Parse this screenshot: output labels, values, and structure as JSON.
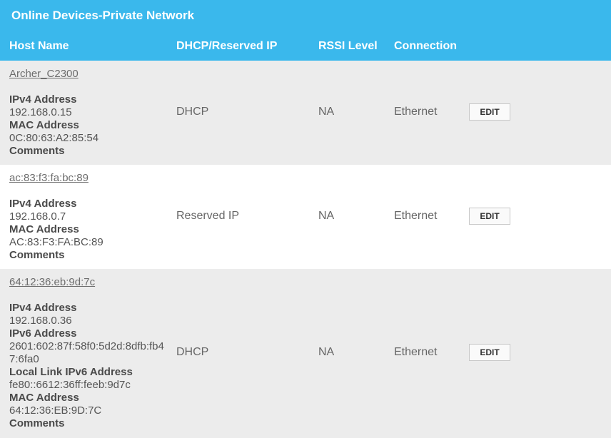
{
  "title": "Online Devices-Private Network",
  "columns": {
    "host": "Host Name",
    "dhcp": "DHCP/Reserved IP",
    "rssi": "RSSI Level",
    "connection": "Connection"
  },
  "devices": [
    {
      "host": "Archer_C2300",
      "ipv4_label": "IPv4 Address",
      "ipv4": "192.168.0.15",
      "mac_label": "MAC Address",
      "mac": "0C:80:63:A2:85:54",
      "comments_label": "Comments",
      "ip_type": "DHCP",
      "rssi": "NA",
      "connection": "Ethernet",
      "edit": "EDIT"
    },
    {
      "host": "ac:83:f3:fa:bc:89",
      "ipv4_label": "IPv4 Address",
      "ipv4": "192.168.0.7",
      "mac_label": "MAC Address",
      "mac": "AC:83:F3:FA:BC:89",
      "comments_label": "Comments",
      "ip_type": "Reserved IP",
      "rssi": "NA",
      "connection": "Ethernet",
      "edit": "EDIT"
    },
    {
      "host": "64:12:36:eb:9d:7c",
      "ipv4_label": "IPv4 Address",
      "ipv4": "192.168.0.36",
      "ipv6_label": "IPv6 Address",
      "ipv6": "2601:602:87f:58f0:5d2d:8dfb:fb47:6fa0",
      "linklocal_label": "Local Link IPv6 Address",
      "linklocal": "fe80::6612:36ff:feeb:9d7c",
      "mac_label": "MAC Address",
      "mac": "64:12:36:EB:9D:7C",
      "comments_label": "Comments",
      "ip_type": "DHCP",
      "rssi": "NA",
      "connection": "Ethernet",
      "edit": "EDIT"
    }
  ]
}
